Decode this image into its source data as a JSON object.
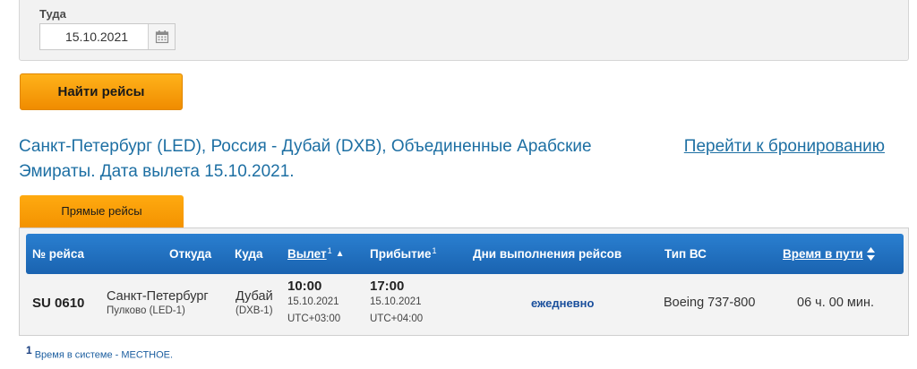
{
  "search": {
    "date_label": "Туда",
    "date_value": "15.10.2021",
    "search_button": "Найти рейсы"
  },
  "route": {
    "title": "Санкт-Петербург (LED), Россия - Дубай (DXB), Объединенные Арабские Эмираты. Дата вылета 15.10.2021.",
    "booking_link": "Перейти к бронированию"
  },
  "tabs": {
    "direct": "Прямые рейсы"
  },
  "table": {
    "headers": {
      "flight_no": "№ рейса",
      "from": "Откуда",
      "to": "Куда",
      "departure": "Вылет",
      "arrival": "Прибытие",
      "days": "Дни выполнения рейсов",
      "aircraft": "Тип ВС",
      "duration": "Время в пути",
      "footnote_mark": "1"
    },
    "rows": [
      {
        "flight_no": "SU 0610",
        "from_city": "Санкт-Петербург",
        "from_airport": "Пулково (LED-1)",
        "to_city": "Дубай",
        "to_airport": "(DXB-1)",
        "dep_time": "10:00",
        "dep_date": "15.10.2021",
        "dep_tz": "UTC+03:00",
        "arr_time": "17:00",
        "arr_date": "15.10.2021",
        "arr_tz": "UTC+04:00",
        "days": "ежедневно",
        "aircraft": "Boeing 737-800",
        "duration": "06 ч. 00 мин."
      }
    ]
  },
  "footnote": {
    "mark": "1",
    "text": "Время в системе - МЕСТНОЕ."
  },
  "icons": {
    "calendar": "calendar-icon",
    "sort_up": "sort-up-icon",
    "sort_both": "sort-both-icon"
  },
  "colors": {
    "accent_orange": "#f39200",
    "header_blue": "#1f6fbf",
    "link_blue": "#1d6fa3"
  }
}
